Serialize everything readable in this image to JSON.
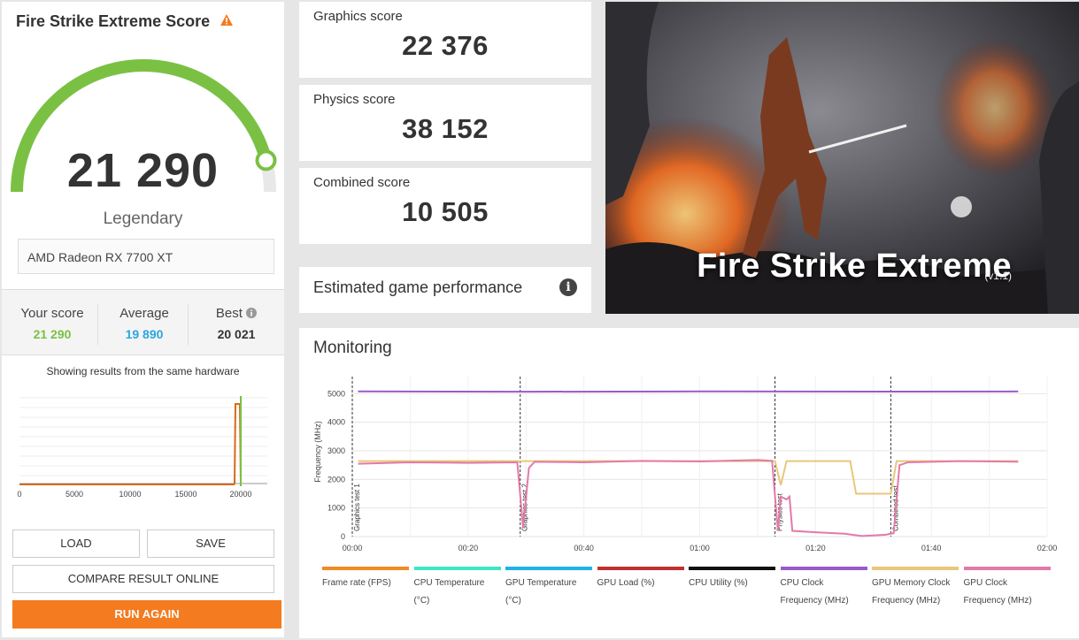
{
  "left": {
    "title": "Fire Strike Extreme Score",
    "warning_icon": "warning-icon",
    "score": "21 290",
    "score_fraction": 0.92,
    "rank": "Legendary",
    "gpu": "AMD Radeon RX 7700 XT",
    "stats": {
      "your_label": "Your score",
      "your_value": "21 290",
      "avg_label": "Average",
      "avg_value": "19 890",
      "best_label": "Best",
      "best_value": "20 021"
    },
    "same_hw": "Showing results from the same hardware",
    "hist_ticks": [
      "0",
      "5000",
      "10000",
      "15000",
      "20000"
    ],
    "buttons": {
      "load": "LOAD",
      "save": "SAVE",
      "compare": "COMPARE RESULT ONLINE",
      "run": "RUN AGAIN"
    }
  },
  "cards": {
    "graphics_label": "Graphics score",
    "graphics_value": "22 376",
    "physics_label": "Physics score",
    "physics_value": "38 152",
    "combined_label": "Combined score",
    "combined_value": "10 505"
  },
  "estimated": {
    "label": "Estimated game performance",
    "info_icon": "info-icon"
  },
  "hero": {
    "title": "Fire Strike Extreme",
    "version": "(v1.1)"
  },
  "monitoring": {
    "title": "Monitoring",
    "ylabel": "Frequency (MHz)",
    "yticks": [
      "0",
      "1000",
      "2000",
      "3000",
      "4000",
      "5000"
    ],
    "xticks": [
      "00:00",
      "00:20",
      "00:40",
      "01:00",
      "01:20",
      "01:40",
      "02:00"
    ],
    "markers": [
      "Graphics test 1",
      "Graphics test 2",
      "Physics test",
      "Combined test"
    ],
    "legend": [
      {
        "label": "Frame rate (FPS)",
        "color": "#f08a24"
      },
      {
        "label": "CPU Temperature (°C)",
        "color": "#3ee6c4"
      },
      {
        "label": "GPU Temperature (°C)",
        "color": "#1fb2ea"
      },
      {
        "label": "GPU Load (%)",
        "color": "#c0312f"
      },
      {
        "label": "CPU Utility (%)",
        "color": "#111111"
      },
      {
        "label": "CPU Clock Frequency (MHz)",
        "color": "#9b59c9"
      },
      {
        "label": "GPU Memory Clock Frequency (MHz)",
        "color": "#e8c77a"
      },
      {
        "label": "GPU Clock Frequency (MHz)",
        "color": "#e37aa8"
      }
    ]
  },
  "colors": {
    "accent": "#f47b20",
    "green": "#7ac143",
    "blue": "#2aa7dc"
  }
}
